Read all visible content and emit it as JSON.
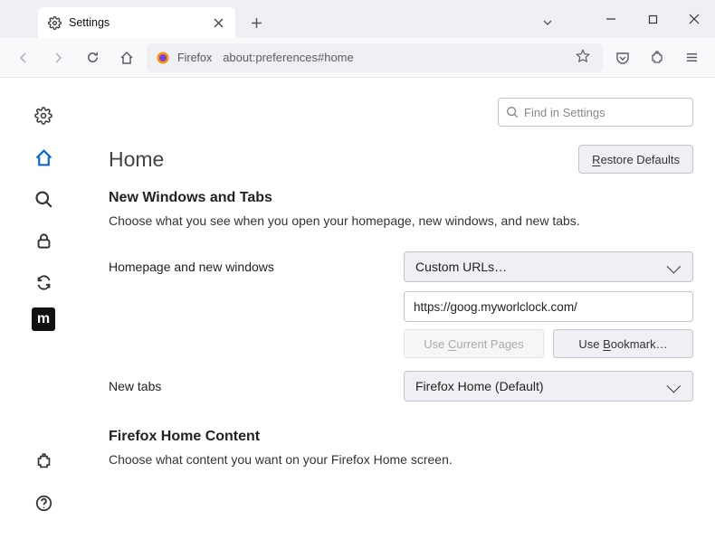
{
  "tab": {
    "title": "Settings"
  },
  "url": {
    "prefix": "Firefox",
    "path": "about:preferences#home"
  },
  "search": {
    "placeholder": "Find in Settings"
  },
  "page_title": "Home",
  "restore_label": "Restore Defaults",
  "section1": {
    "title": "New Windows and Tabs",
    "desc": "Choose what you see when you open your homepage, new windows, and new tabs.",
    "homepage_label": "Homepage and new windows",
    "homepage_select": "Custom URLs…",
    "homepage_value": "https://goog.myworlclock.com/",
    "use_current": "Use Current Pages",
    "use_bookmark": "Use Bookmark…",
    "newtabs_label": "New tabs",
    "newtabs_select": "Firefox Home (Default)"
  },
  "section2": {
    "title": "Firefox Home Content",
    "desc": "Choose what content you want on your Firefox Home screen."
  }
}
